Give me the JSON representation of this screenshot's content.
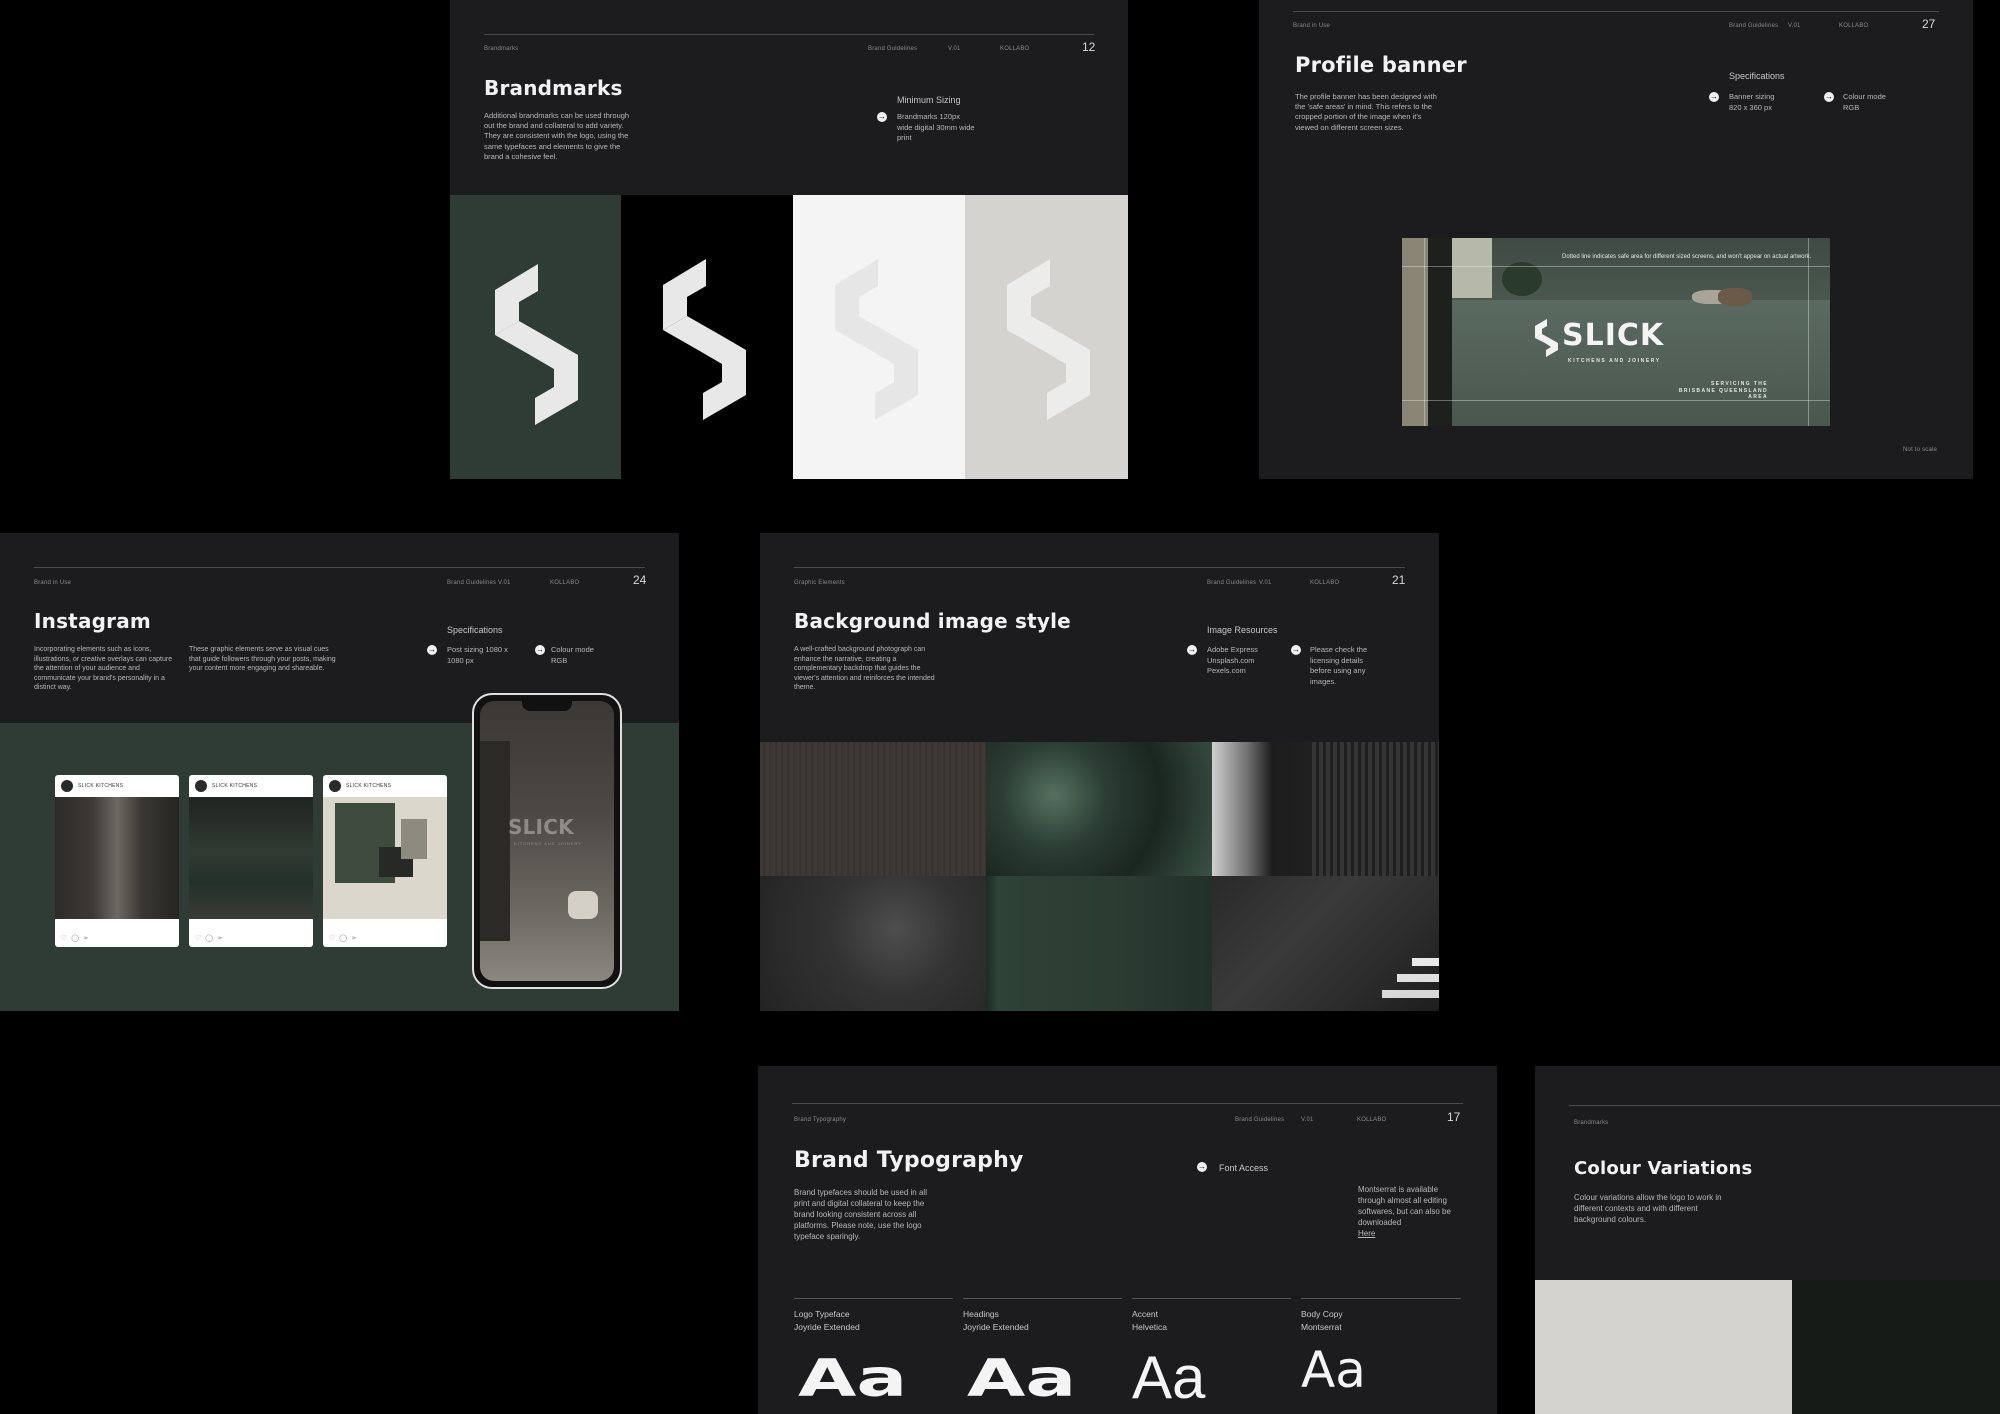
{
  "brandmarks": {
    "section": "Brandmarks",
    "guidelines": "Brand Guidelines",
    "version": "V.01",
    "agency": "KOLLABO",
    "page": "12",
    "title": "Brandmarks",
    "description": "Additional brandmarks can be used through out the brand and collateral to add variety. They are consistent with the logo, using the same typefaces and elements to give the brand a cohesive feel.",
    "spec_heading": "Minimum Sizing",
    "spec_text": "Brandmarks 120px wide digital 30mm wide print",
    "swatches": [
      "#2f3b35",
      "#000000",
      "#f4f4f4",
      "#d4d3cf"
    ]
  },
  "profile_banner": {
    "section": "Brand in Use",
    "guidelines": "Brand Guidelines",
    "version": "V.01",
    "agency": "KOLLABO",
    "page": "27",
    "title": "Profile banner",
    "description": "The profile banner has been designed with the 'safe areas' in mind. This refers to the cropped portion of the image when it's viewed on different screen sizes.",
    "spec_heading": "Specifications",
    "spec_1": "Banner sizing 820 x 360 px",
    "spec_2": "Colour mode RGB",
    "banner_note": "Dotted line indicates safe area for different sized screens, and won't appear on actual artwork.",
    "banner_brand": "SLICK",
    "banner_tagline": "KITCHENS AND JOINERY",
    "banner_area": "SERVICING THE BRISBANE QUEENSLAND AREA",
    "scale_note": "Not to scale"
  },
  "instagram": {
    "section": "Brand in Use",
    "guidelines": "Brand Guidelines",
    "version": "V.01",
    "agency": "KOLLABO",
    "page": "24",
    "title": "Instagram",
    "description_1": "Incorporating elements such as icons, illustrations, or creative overlays can capture the attention of your audience and communicate your brand's personality in a distinct way.",
    "description_2": "These graphic elements serve as visual cues that guide followers through your posts, making your content more engaging and shareable.",
    "spec_heading": "Specifications",
    "spec_1": "Post sizing 1080 x 1080 px",
    "spec_2": "Colour mode RGB",
    "account": "SLICK KITCHENS",
    "post_icons": "♡ ◯ ➢",
    "phone_brand": "SLICK",
    "phone_tagline": "KITCHENS AND JOINERY"
  },
  "background": {
    "section": "Graphic Elements",
    "guidelines": "Brand Guidelines",
    "version": "V.01",
    "agency": "KOLLABO",
    "page": "21",
    "title": "Background image style",
    "description": "A well-crafted background photograph can enhance the narrative, creating a complementary backdrop that guides the viewer's attention and reinforces the intended theme.",
    "spec_heading": "Image Resources",
    "spec_1": "Adobe Express Unsplash.com Pexels.com",
    "spec_2": "Please check the licensing details before using any images."
  },
  "typography": {
    "section": "Brand Typography",
    "guidelines": "Brand Guidelines",
    "version": "V.01",
    "agency": "KOLLABO",
    "page": "17",
    "title": "Brand Typography",
    "description": "Brand typefaces should be used in all print and digital collateral to keep the brand looking consistent across all platforms. Please note, use the logo typeface sparingly.",
    "font_access": "Font Access",
    "font_note": "Montserrat is available through almost all editing softwares, but can also be downloaded",
    "font_link": "Here",
    "sample": "Aa",
    "fonts": [
      {
        "role": "Logo Typeface",
        "name": "Joyride Extended"
      },
      {
        "role": "Headings",
        "name": "Joyride Extended"
      },
      {
        "role": "Accent",
        "name": "Helvetica"
      },
      {
        "role": "Body Copy",
        "name": "Montserrat"
      }
    ]
  },
  "colour": {
    "section": "Brandmarks",
    "title": "Colour Variations",
    "description": "Colour variations allow the logo to work in different contexts and with different background colours.",
    "swatches": [
      "#d4d3cf",
      "#141a16"
    ]
  }
}
